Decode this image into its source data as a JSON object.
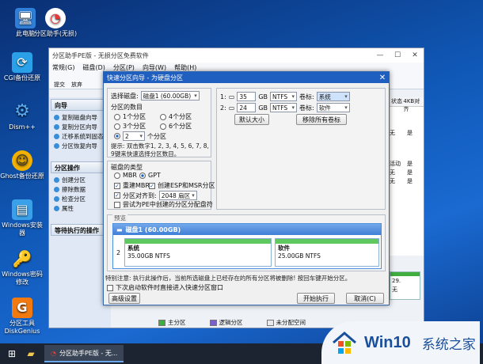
{
  "desktop": {
    "icons": [
      {
        "label": "此电脑",
        "icon": "computer-icon",
        "color": "#2f7fd8"
      },
      {
        "label": "分区助手(无损)",
        "icon": "partition-assistant-icon",
        "color": "#e23b3b"
      },
      {
        "label": "CGI备份还原",
        "icon": "cgi-icon",
        "color": "#2aa0e8"
      },
      {
        "label": "Dism++",
        "icon": "gear-icon",
        "color": "#3c8fe0"
      },
      {
        "label": "Ghost备份还原",
        "icon": "ghost-icon",
        "color": "#f2b000"
      },
      {
        "label": "Windows安装器",
        "icon": "windows-installer-icon",
        "color": "#3aa0e8"
      },
      {
        "label": "Windows密码修改",
        "icon": "key-icon",
        "color": "#f0b400"
      },
      {
        "label": "分区工具DiskGenius",
        "icon": "diskgenius-icon",
        "color": "#f07a10"
      }
    ]
  },
  "app": {
    "title": "分区助手PE版 - 无损分区免费软件",
    "menu": [
      "常规(G)",
      "磁盘(D)",
      "分区(P)",
      "向导(W)",
      "帮助(H)"
    ],
    "toolbar": [
      "提交",
      "放弃"
    ],
    "sidebar": {
      "wizard_head": "向导",
      "wizard_items": [
        "复制磁盘向导",
        "复制分区向导",
        "迁移系统到固态",
        "分区恢复向导"
      ],
      "ops_head": "分区操作",
      "ops_items": [
        "创建分区",
        "擦除数据",
        "检查分区",
        "属性"
      ],
      "pending_head": "等待执行的操作"
    },
    "grid": {
      "headers": [
        "状态",
        "4KB对齐"
      ],
      "rows": [
        [
          "无",
          "是"
        ],
        [
          "活动",
          "是"
        ],
        [
          "无",
          "是"
        ],
        [
          "无",
          "是"
        ]
      ]
    },
    "legend": [
      "主分区",
      "逻辑分区",
      "未分配空间"
    ],
    "legend_colors": [
      "#3fae3f",
      "#7a5fc8",
      "#e8e8e8"
    ],
    "minimap_size": "29.",
    "minimap_label": "无"
  },
  "dialog": {
    "title": "快速分区向导 - 为硬盘分区",
    "close": "✕",
    "select_disk_label": "选择磁盘:",
    "select_disk_value": "磁盘1 (60.00GB)",
    "partition_count_label": "分区的数目",
    "count_options": [
      "1个分区",
      "4个分区",
      "3个分区",
      "5个分区",
      "6个分区"
    ],
    "count_selected_value": "2",
    "count_selected_unit": "个分区",
    "hint": "提示: 双击数字1, 2, 3, 4, 5, 6, 7, 8, 9键来快速选择分区数目。",
    "disk_type_label": "磁盘的类型",
    "mbr": "MBR",
    "gpt": "GPT",
    "rebuild_mbr": "重建MBR",
    "create_esp": "创建ESP和MSR分区",
    "align_label": "分区对齐到:",
    "align_value": "2048 扇区",
    "pe_restore": "尝试为PE中创建的分区分配盘符",
    "partitions": [
      {
        "num": "1:",
        "size": "35",
        "unit": "GB",
        "fs": "NTFS",
        "vol_label": "卷标:",
        "name": "系统"
      },
      {
        "num": "2:",
        "size": "24",
        "unit": "GB",
        "fs": "NTFS",
        "vol_label": "卷标:",
        "name": "软件"
      }
    ],
    "default_size_btn": "默认大小",
    "remove_labels_btn": "移除所有卷标",
    "preview_label": "预览",
    "disk_name": "磁盘1 (60.00GB)",
    "preview_parts": [
      {
        "name": "系统",
        "detail": "35.00GB NTFS"
      },
      {
        "name": "软件",
        "detail": "25.00GB NTFS"
      }
    ],
    "preview_index": "2",
    "warning": "特别注意: 执行此操作后，当前所选磁盘上已经存在的所有分区将被删除! 按回车键开始分区。",
    "no_wizard": "下次启动软件时直接进入快速分区窗口",
    "advanced_btn": "高级设置",
    "start_btn": "开始执行",
    "cancel_btn": "取消(C)"
  },
  "taskbar": {
    "app_label": "分区助手PE版 - 无..."
  },
  "watermark": {
    "brand": "Win10",
    "sub": "系统之家"
  }
}
